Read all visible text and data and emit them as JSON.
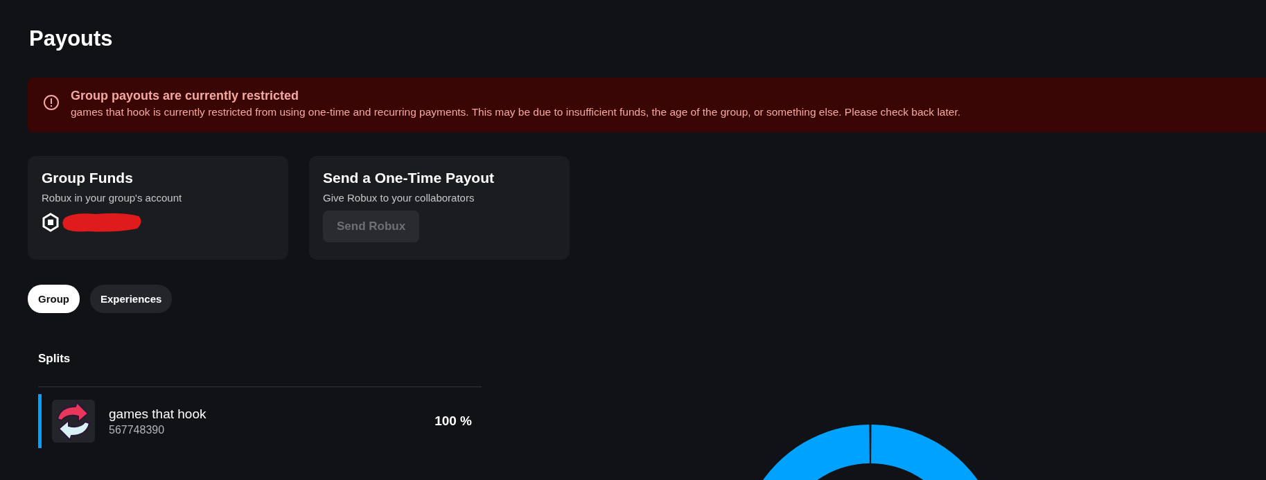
{
  "page": {
    "title": "Payouts"
  },
  "alert": {
    "title": "Group payouts are currently restricted",
    "message": "games that hook is currently restricted from using one-time and recurring payments. This may be due to insufficient funds, the age of the group, or something else. Please check back later."
  },
  "cards": [
    {
      "kind": "funds",
      "title": "Group Funds",
      "subtitle": "Robux in your group's account"
    },
    {
      "kind": "action",
      "title": "Send a One-Time Payout",
      "subtitle": "Give Robux to your collaborators",
      "button": {
        "label": "Send Robux",
        "disabled": true
      }
    }
  ],
  "tabs": [
    {
      "label": "Group",
      "selected": true
    },
    {
      "label": "Experiences",
      "selected": false
    }
  ],
  "splits": {
    "title": "Splits",
    "rows": [
      {
        "name": "games that hook",
        "id": "567748390",
        "percent": "100 %",
        "color": "#00a2ff"
      }
    ]
  }
}
